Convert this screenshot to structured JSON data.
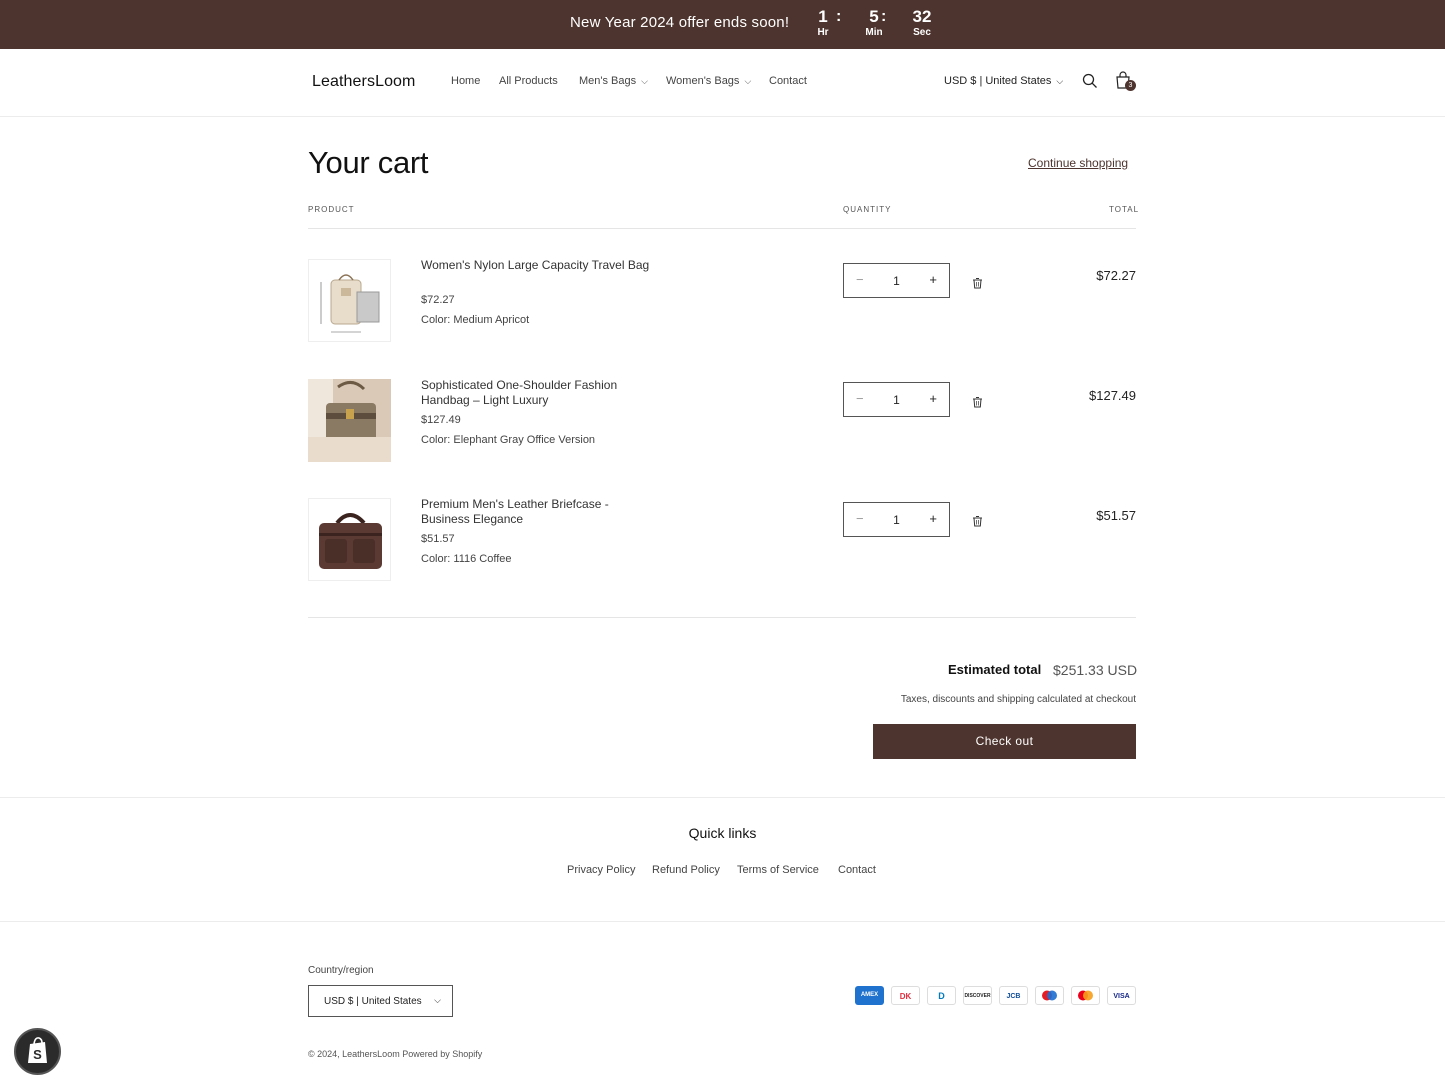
{
  "announcement": {
    "text": "New Year 2024 offer ends soon!",
    "countdown": [
      {
        "value": "1",
        "label": "Hr"
      },
      {
        "value": "5",
        "label": "Min"
      },
      {
        "value": "32",
        "label": "Sec"
      }
    ],
    "separator": ":"
  },
  "header": {
    "logo": "LeathersLoom",
    "nav": [
      "Home",
      "All Products",
      "Men's Bags",
      "Women's Bags",
      "Contact"
    ],
    "currency": "USD $ | United States",
    "cart_count": "3"
  },
  "cart": {
    "title": "Your cart",
    "continue_label": "Continue shopping",
    "col_product": "PRODUCT",
    "col_quantity": "QUANTITY",
    "col_total": "TOTAL",
    "items": [
      {
        "name": "Women's Nylon Large Capacity Travel Bag",
        "price": "$72.27",
        "color": "Color: Medium Apricot",
        "qty": "1",
        "total": "$72.27"
      },
      {
        "name": "Sophisticated One-Shoulder Fashion Handbag – Light Luxury",
        "price": "$127.49",
        "color": "Color: Elephant Gray Office Version",
        "qty": "1",
        "total": "$127.49"
      },
      {
        "name": "Premium Men's Leather Briefcase - Business Elegance",
        "price": "$51.57",
        "color": "Color: 1116 Coffee",
        "qty": "1",
        "total": "$51.57"
      }
    ],
    "qty_minus": "−",
    "qty_plus": "+"
  },
  "summary": {
    "estimated_label": "Estimated total",
    "estimated_value": "$251.33 USD",
    "tax_note": "Taxes, discounts and shipping calculated at checkout",
    "checkout_label": "Check out"
  },
  "footer": {
    "quick_links_title": "Quick links",
    "links": [
      "Privacy Policy",
      "Refund Policy",
      "Terms of Service",
      "Contact"
    ],
    "country_label": "Country/region",
    "country_value": "USD $ | United States",
    "payment_icons": [
      "amex-icon",
      "dankort-icon",
      "diners-club-icon",
      "discover-icon",
      "jcb-icon",
      "maestro-icon",
      "mastercard-icon",
      "visa-icon"
    ],
    "payment_text": {
      "amex": "AMEX",
      "dankort": "DK",
      "diners": "D",
      "discover": "DISCOVER",
      "jcb": "JCB",
      "visa": "VISA"
    },
    "copyright": "© 2024, LeathersLoom Powered by Shopify"
  },
  "colors": {
    "brand": "#4e342e"
  }
}
